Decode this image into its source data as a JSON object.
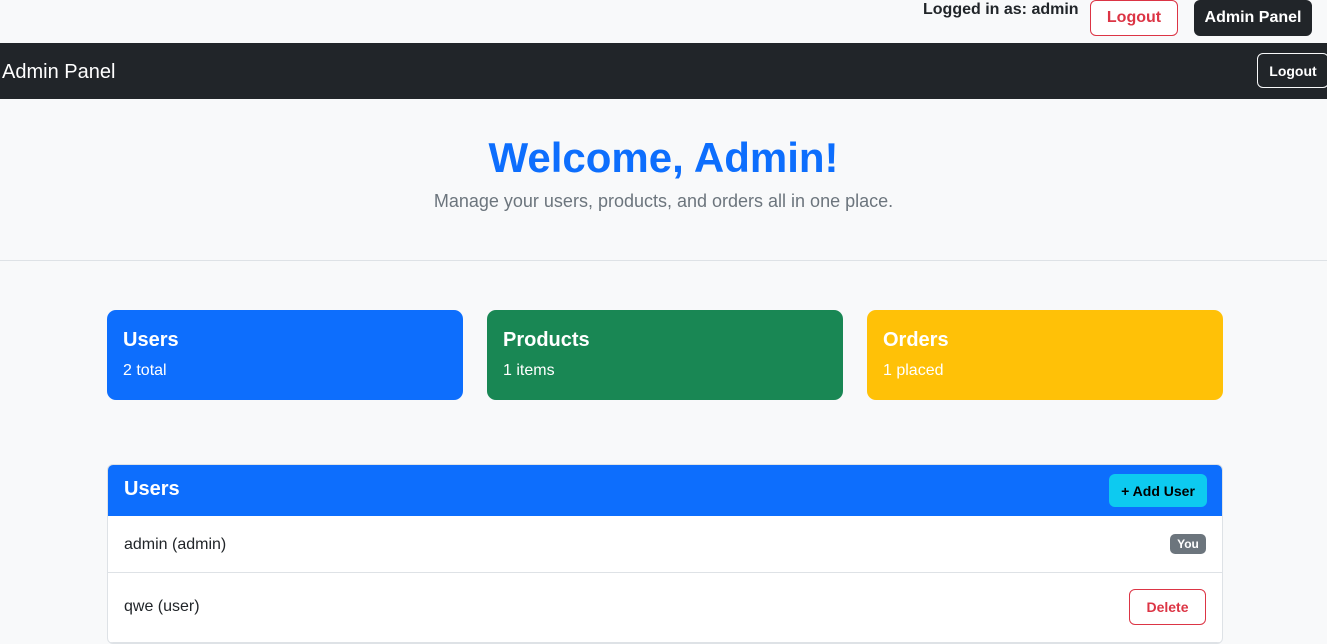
{
  "topbar": {
    "logged_in_text": "Logged in as: admin",
    "logout_label": "Logout",
    "admin_panel_label": "Admin Panel"
  },
  "navbar": {
    "brand": "Admin Panel",
    "logout_label": "Logout"
  },
  "hero": {
    "title": "Welcome, Admin!",
    "subtitle": "Manage your users, products, and orders all in one place."
  },
  "stats": [
    {
      "title": "Users",
      "subtitle": "2 total",
      "color": "#0d6efd"
    },
    {
      "title": "Products",
      "subtitle": "1 items",
      "color": "#198754"
    },
    {
      "title": "Orders",
      "subtitle": "1 placed",
      "color": "#ffc107"
    }
  ],
  "users_card": {
    "title": "Users",
    "add_label": "+ Add User",
    "rows": [
      {
        "name": "admin (admin)",
        "badge": "You"
      },
      {
        "name": "qwe (user)",
        "action": "Delete"
      }
    ]
  },
  "colors": {
    "primary": "#0d6efd",
    "success": "#198754",
    "warning": "#ffc107",
    "danger": "#dc3545",
    "dark": "#212529",
    "info": "#0dcaf0",
    "secondary": "#6c757d"
  }
}
